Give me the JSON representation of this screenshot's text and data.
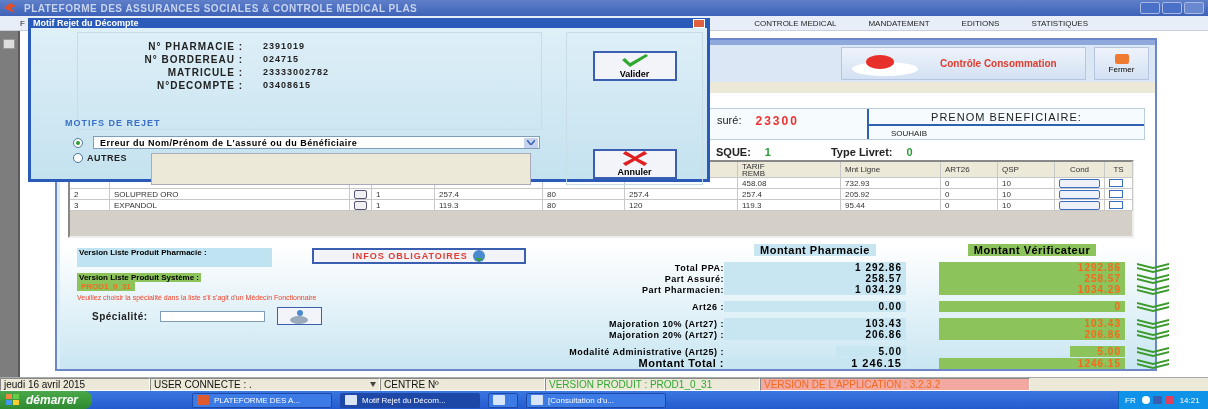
{
  "window": {
    "title": "PLATEFORME DES ASSURANCES SOCIALES & CONTROLE MEDICAL PLAS"
  },
  "menu": [
    {
      "label": "F"
    },
    {
      "label": "CONTROLE MEDICAL"
    },
    {
      "label": "MANDATEMENT"
    },
    {
      "label": "EDITIONS"
    },
    {
      "label": "STATISTIQUES"
    }
  ],
  "toolbar": {
    "consommation_button": "Contrôle Consommation",
    "close_button": "Fermer"
  },
  "assure": {
    "label": "suré:",
    "value": "23300"
  },
  "beneficiary": {
    "label": "PRENOM BENEFICIAIRE:",
    "value": "SOUHAIB"
  },
  "risk": {
    "label": "SQUE:",
    "value": "1"
  },
  "livret": {
    "label": "Type Livret:",
    "value": "0"
  },
  "table": {
    "columns": [
      "TARIF\nREMB",
      "Mnt Ligne",
      "ART26",
      "QSP",
      "Cond",
      "TS"
    ],
    "rows": [
      {
        "tarif": "458.08",
        "amount": "732.93",
        "art26": "0",
        "qsp": "10",
        "ts_checked": false
      },
      {
        "number": "2",
        "product": "SOLUPRED ORO",
        "quantity": "1",
        "col_4": "257.4",
        "col_5": "80",
        "col_6": "257.4",
        "tarif": "257.4",
        "amount": "205.92",
        "art26": "0",
        "qsp": "10",
        "ts_checked": false
      },
      {
        "number": "3",
        "product": "EXPANDOL",
        "quantity": "1",
        "col_4": "119.3",
        "col_5": "80",
        "col_6": "120",
        "tarif": "119.3",
        "amount": "95.44",
        "art26": "0",
        "qsp": "10",
        "ts_checked": false
      }
    ]
  },
  "versions": {
    "pharmacy_label": "Version Liste Produit Pharmacie :",
    "infos_button": "INFOS OBLIGATOIRES",
    "system_label": "Version Liste Produit Système :",
    "system_value": "PROD1_0_31",
    "warning": "Veuillez choisir la spécialité dans la liste s'il s'agit d'un Médecin Fonctionnaire",
    "specialty_label": "Spécialité:"
  },
  "amounts": {
    "pharmacy_header": "Montant Pharmacie",
    "verifier_header": "Montant Vérificateur",
    "groups": [
      {
        "rows": [
          {
            "kind": "line",
            "label": "Total PPA:",
            "pharmacy": "1 292.86",
            "verifier": "1292.86"
          },
          {
            "kind": "line",
            "label": "Part Assuré:",
            "pharmacy": "258.57",
            "verifier": "258.57"
          },
          {
            "kind": "line",
            "label": "Part Pharmacien:",
            "pharmacy": "1 034.29",
            "verifier": "1034.29"
          }
        ]
      },
      {
        "rows": [
          {
            "kind": "line",
            "label": "Art26 :",
            "pharmacy": "0.00",
            "verifier": "0"
          }
        ]
      },
      {
        "rows": [
          {
            "kind": "line",
            "label": "Majoration 10% (Art27) :",
            "pharmacy": "103.43",
            "verifier": "103.43"
          },
          {
            "kind": "line",
            "label": "Majoration 20% (Art27) :",
            "pharmacy": "206.86",
            "verifier": "206.86"
          }
        ]
      },
      {
        "rows": [
          {
            "kind": "fee",
            "label": "Modalité Administrative (Art25) :",
            "pharmacy": "5.00",
            "verifier": "5.00"
          },
          {
            "kind": "total",
            "label": "Montant Total :",
            "pharmacy": "1 246.15",
            "verifier": "1246.15"
          }
        ]
      }
    ]
  },
  "status_bar": {
    "date": "jeudi 16 avril 2015",
    "user": "USER CONNECTE : .",
    "centre": "CENTRE Nº",
    "product_version": "VERSION PRODUIT : PROD1_0_31",
    "app_version": "VERSION DE L'APPLICATION : 3.2.3.2"
  },
  "taskbar": {
    "start": "démarrer",
    "tasks": [
      {
        "label": "PLATEFORME DES A...",
        "selected": false
      },
      {
        "label": "Motif Rejet du Décom...",
        "selected": true
      },
      {
        "selected": false
      },
      {
        "label": "[Consultation d'u...",
        "selected": false
      }
    ],
    "language": "FR",
    "time": "14:21"
  },
  "dialog": {
    "title": "Motif Rejet du Décompte",
    "fields": [
      {
        "label": "N° PHARMACIE :",
        "value": "2391019"
      },
      {
        "label": "N° BORDEREAU :",
        "value": "024715"
      },
      {
        "label": "MATRICULE :",
        "value": "23333002782"
      },
      {
        "label": "N°DECOMPTE :",
        "value": "03408615"
      }
    ],
    "motifs_title": "MOTIFS DE REJET",
    "options": [
      {
        "kind": "select",
        "selected": true,
        "value": "Erreur du Nom/Prénom de L'assuré ou du Bénéficiaire"
      },
      {
        "kind": "text",
        "selected": false,
        "label": "AUTRES"
      }
    ],
    "buttons": [
      {
        "kind": "ok",
        "label": "Valider"
      },
      {
        "kind": "cancel",
        "label": "Annuler"
      }
    ]
  }
}
